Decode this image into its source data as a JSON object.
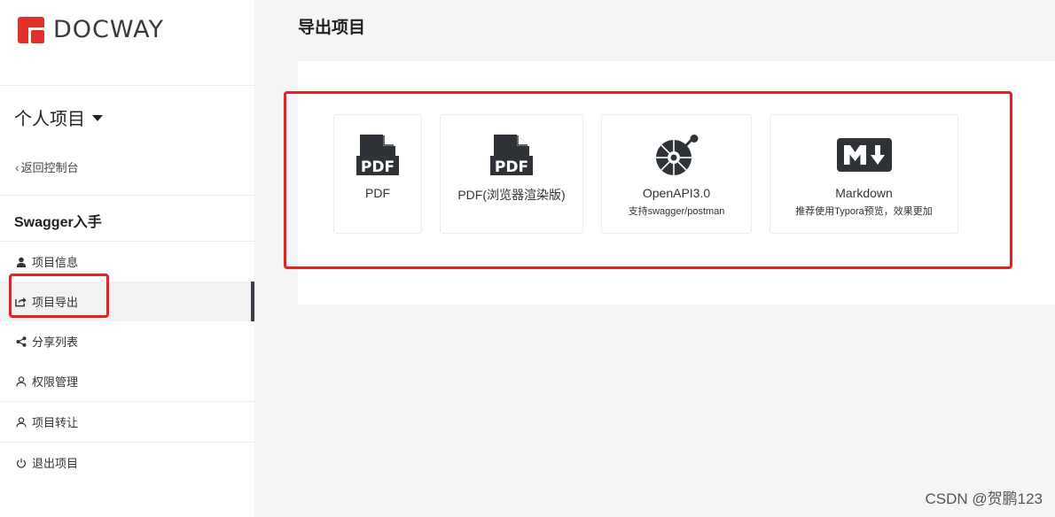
{
  "brand": {
    "name": "DOCWAY"
  },
  "project_switch": {
    "label": "个人项目"
  },
  "back_link": {
    "label": "返回控制台"
  },
  "project_name": "Swagger入手",
  "menu": [
    {
      "label": "项目信息",
      "icon": "user-icon"
    },
    {
      "label": "项目导出",
      "icon": "share-out-icon",
      "active": true
    },
    {
      "label": "分享列表",
      "icon": "share-icon"
    },
    {
      "label": "权限管理",
      "icon": "user-outline-icon"
    },
    {
      "label": "项目转让",
      "icon": "user-transfer-icon"
    },
    {
      "label": "退出项目",
      "icon": "power-icon"
    }
  ],
  "page_title": "导出项目",
  "export_options": [
    {
      "name": "PDF",
      "subtitle": "",
      "icon": "pdf-icon",
      "badge": "PDF"
    },
    {
      "name": "PDF(浏览器渲染版)",
      "subtitle": "",
      "icon": "pdf-icon",
      "badge": "PDF"
    },
    {
      "name": "OpenAPI3.0",
      "subtitle": "支持swagger/postman",
      "icon": "openapi-icon"
    },
    {
      "name": "Markdown",
      "subtitle": "推荐使用Typora预览，效果更加",
      "icon": "markdown-icon"
    }
  ],
  "colors": {
    "annotation": "#e6211f",
    "brand_red": "#e0312c",
    "active_bar": "#3a3f45"
  },
  "watermark": "CSDN @贺鹏123"
}
